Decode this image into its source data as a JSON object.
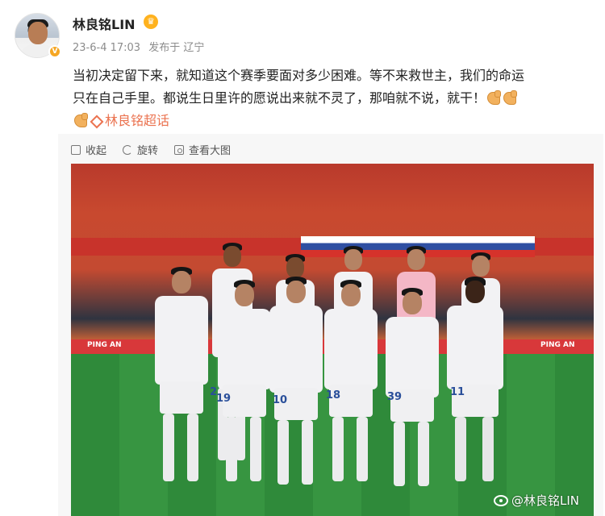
{
  "post": {
    "username": "林良铭LIN",
    "timestamp": "23-6-4 17:03",
    "source": "发布于 辽宁",
    "text_line1": "当初决定留下来，就知道这个赛季要面对多少困难。等不来救世主，我们的命运",
    "text_line2": "只在自己手里。都说生日里许的愿说出来就不灵了，那咱就不说，就干！",
    "topic": "林良铭超话",
    "vip_badge": "V"
  },
  "toolbar": {
    "collapse_label": "收起",
    "rotate_label": "旋转",
    "view_large_label": "查看大图"
  },
  "photo": {
    "watermark": "@林良铭LIN",
    "jersey_numbers": [
      "2",
      "19",
      "10",
      "18",
      "39",
      "11"
    ],
    "adboard_left": "PING AN",
    "adboard_right": "PING AN"
  },
  "colors": {
    "topic_accent": "#eb7350",
    "vip_badge": "#f5a623"
  }
}
